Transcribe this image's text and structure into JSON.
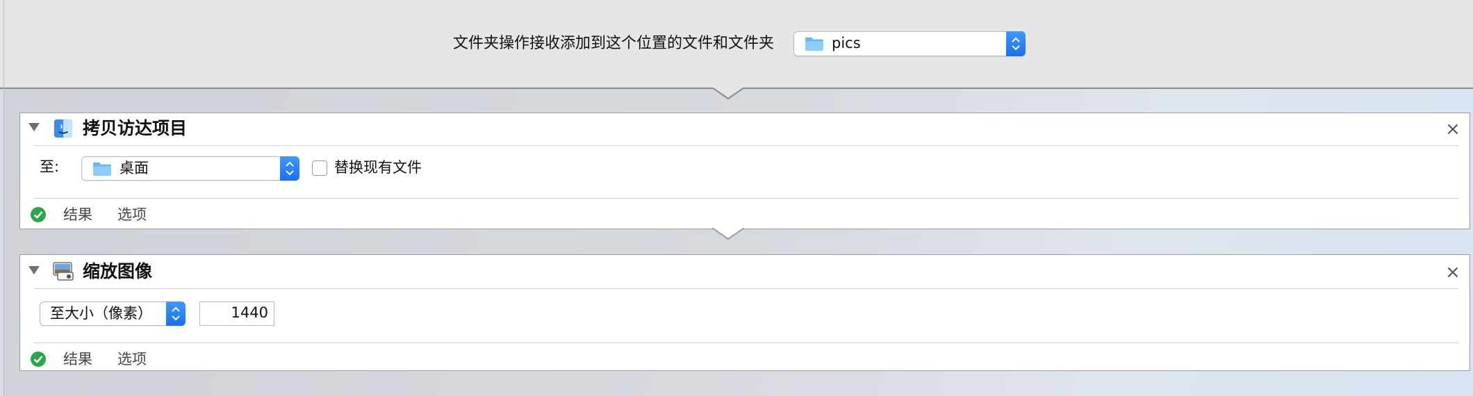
{
  "header": {
    "label": "文件夹操作接收添加到这个位置的文件和文件夹",
    "folder_popup": {
      "value": "pics",
      "icon": "folder-icon"
    }
  },
  "actions": [
    {
      "title": "拷贝访达项目",
      "icon": "finder-icon",
      "to_label": "至:",
      "destination_popup": {
        "value": "桌面",
        "icon": "folder-icon"
      },
      "replace_checkbox": {
        "label": "替换现有文件",
        "checked": false
      },
      "tabs": [
        "结果",
        "选项"
      ]
    },
    {
      "title": "缩放图像",
      "icon": "image-scale-icon",
      "size_popup": {
        "value": "至大小（像素）"
      },
      "size_value": "1440",
      "tabs": [
        "结果",
        "选项"
      ]
    }
  ],
  "colors": {
    "accent": "#1a6ff0",
    "check": "#28a745",
    "folder": "#7cc4f8"
  }
}
